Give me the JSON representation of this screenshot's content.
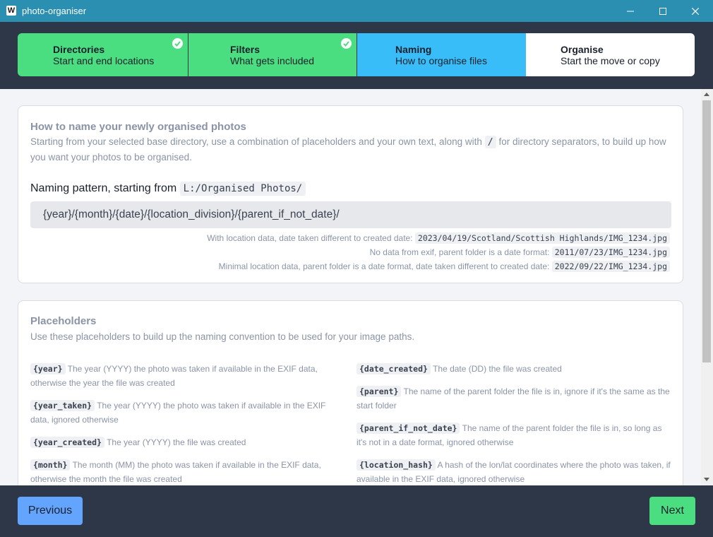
{
  "window": {
    "title": "photo-organiser",
    "app_icon": "W"
  },
  "steps": [
    {
      "title": "Directories",
      "subtitle": "Start and end locations",
      "state": "done",
      "color": "#4ade80"
    },
    {
      "title": "Filters",
      "subtitle": "What gets included",
      "state": "done",
      "color": "#4ade80"
    },
    {
      "title": "Naming",
      "subtitle": "How to organise files",
      "state": "active",
      "color": "#38bdf8"
    },
    {
      "title": "Organise",
      "subtitle": "Start the move or copy",
      "state": "pending",
      "color": "#ffffff"
    }
  ],
  "naming": {
    "title": "How to name your newly organised photos",
    "desc_before": "Starting from your selected base directory, use a combination of placeholders and your own text, along with",
    "desc_code": "/",
    "desc_after": "for directory separators, to build up how you want your photos to be organised.",
    "pattern_label": "Naming pattern, starting from",
    "base_dir": "L:/Organised Photos/",
    "pattern_value": "{year}/{month}/{date}/{location_division}/{parent_if_not_date}/",
    "examples": [
      {
        "label": "With location data, date taken different to created date:",
        "path": "2023/04/19/Scotland/Scottish Highlands/IMG_1234.jpg"
      },
      {
        "label": "No data from exif, parent folder is a date format:",
        "path": "2011/07/23/IMG_1234.jpg"
      },
      {
        "label": "Minimal location data, parent folder is a date format, date taken different to created date:",
        "path": "2022/09/22/IMG_1234.jpg"
      }
    ]
  },
  "placeholders": {
    "title": "Placeholders",
    "desc": "Use these placeholders to build up the naming convention to be used for your image paths.",
    "left": [
      {
        "name": "{year}",
        "text": "The year (YYYY) the photo was taken if available in the EXIF data, otherwise the year the file was created"
      },
      {
        "name": "{year_taken}",
        "text": "The year (YYYY) the photo was taken if available in the EXIF data, ignored otherwise"
      },
      {
        "name": "{year_created}",
        "text": "The year (YYYY) the file was created"
      },
      {
        "name": "{month}",
        "text": "The month (MM) the photo was taken if available in the EXIF data, otherwise the month the file was created"
      }
    ],
    "right": [
      {
        "name": "{date_created}",
        "text": "The date (DD) the file was created"
      },
      {
        "name": "{parent}",
        "text": "The name of the parent folder the file is in, ignore if it's the same as the start folder"
      },
      {
        "name": "{parent_if_not_date}",
        "text": "The name of the parent folder the file is in, so long as it's not in a date format, ignored otherwise"
      },
      {
        "name": "{location_hash}",
        "text": "A hash of the lon/lat coordinates where the photo was taken, if available in the EXIF data, ignored otherwise"
      }
    ]
  },
  "footer": {
    "previous_label": "Previous",
    "next_label": "Next"
  }
}
